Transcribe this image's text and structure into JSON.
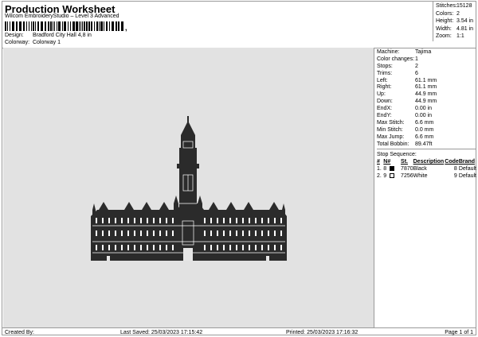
{
  "header": {
    "title": "Production Worksheet",
    "subtitle": "Wilcom EmbroideryStudio – Level 3 Advanced",
    "barcode_suffix": ",",
    "design_label": "Design:",
    "design_value": "Bradford City Hall 4,8 in",
    "colorway_label": "Colorway:",
    "colorway_value": "Colorway 1"
  },
  "stats": [
    {
      "label": "Stitches:",
      "value": "15128"
    },
    {
      "label": "Colors:",
      "value": "2"
    },
    {
      "label": "Height:",
      "value": "3.54 in"
    },
    {
      "label": "Width:",
      "value": "4.81 in"
    },
    {
      "label": "Zoom:",
      "value": "1:1"
    }
  ],
  "machine": [
    {
      "label": "Machine:",
      "value": "Tajima"
    },
    {
      "label": "Color changes:",
      "value": "1"
    },
    {
      "label": "Stops:",
      "value": "2"
    },
    {
      "label": "Trims:",
      "value": "6"
    },
    {
      "label": "Left:",
      "value": "61.1 mm"
    },
    {
      "label": "Right:",
      "value": "61.1 mm"
    },
    {
      "label": "Up:",
      "value": "44.9 mm"
    },
    {
      "label": "Down:",
      "value": "44.9 mm"
    },
    {
      "label": "EndX:",
      "value": "0.00 in"
    },
    {
      "label": "EndY:",
      "value": "0.00 in"
    },
    {
      "label": "Max Stitch:",
      "value": "6.6 mm"
    },
    {
      "label": "Min Stitch:",
      "value": "0.0 mm"
    },
    {
      "label": "Max Jump:",
      "value": "6.6 mm"
    },
    {
      "label": "Total Bobbin:",
      "value": "89.47ft"
    }
  ],
  "stop_sequence": {
    "title": "Stop Sequence:",
    "headers": {
      "idx": "#",
      "n": "N#",
      "st": "St.",
      "desc": "Description",
      "code": "Code",
      "brand": "Brand"
    },
    "rows": [
      {
        "idx": "1.",
        "n": "8",
        "color": "#000000",
        "st": "7870",
        "desc": "Black",
        "code": "8",
        "brand": "Default"
      },
      {
        "idx": "2.",
        "n": "9",
        "color": "#ffffff",
        "st": "7256",
        "desc": "White",
        "code": "9",
        "brand": "Default"
      }
    ]
  },
  "footer": {
    "created_by": "Created By:",
    "last_saved": "Last Saved: 25/03/2023 17:15:42",
    "printed": "Printed: 25/03/2023 17:16:32",
    "page": "Page 1 of 1"
  },
  "colors": {
    "canvas_bg": "#e2e2e2",
    "building": "#2b2b2b",
    "detail": "#ffffff"
  }
}
